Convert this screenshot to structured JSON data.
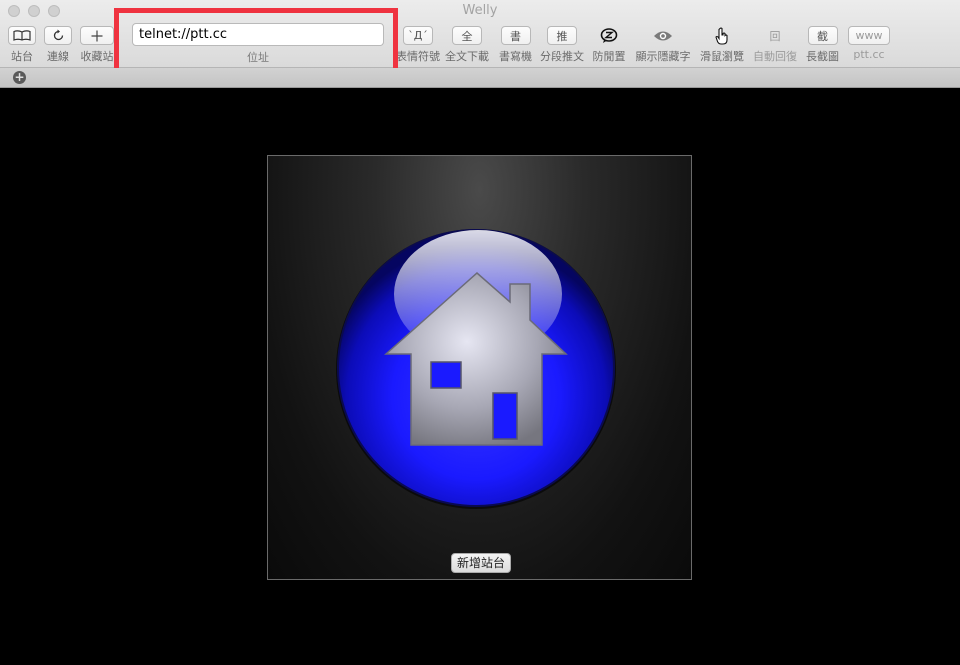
{
  "window": {
    "title": "Welly"
  },
  "toolbar": {
    "sites": {
      "icon": "book-icon",
      "label": "站台"
    },
    "connect": {
      "icon": "reload-icon",
      "label": "連線"
    },
    "bookmark": {
      "icon": "plus-icon",
      "label": "收藏站"
    },
    "address": {
      "value": "telnet://ptt.cc",
      "label": "位址"
    },
    "emoticon": {
      "glyph": "`Д´",
      "label": "表情符號"
    },
    "download_all": {
      "glyph": "全",
      "label": "全文下載"
    },
    "composer": {
      "glyph": "書",
      "label": "書寫機"
    },
    "segment_push": {
      "glyph": "推",
      "label": "分段推文"
    },
    "anti_idle": {
      "icon": "zzz-bubble-icon",
      "label": "防閒置"
    },
    "show_hidden": {
      "icon": "eye-icon",
      "label": "顯示隱藏字"
    },
    "mouse_browse": {
      "icon": "pointing-hand-icon",
      "label": "滑鼠瀏覽"
    },
    "auto_reply": {
      "glyph": "回",
      "label": "自動回復"
    },
    "long_screenshot": {
      "glyph": "截",
      "label": "長截圖"
    },
    "ptt": {
      "glyph": "www",
      "label": "ptt.cc"
    }
  },
  "tabs": {
    "add_icon": "plus-circle-icon",
    "add_glyph": "+"
  },
  "content": {
    "emblem_icon": "home-orb-icon",
    "add_site_label": "新增站台"
  },
  "colors": {
    "highlight": "#ef3340",
    "orb_blue": "#1a1aff"
  }
}
